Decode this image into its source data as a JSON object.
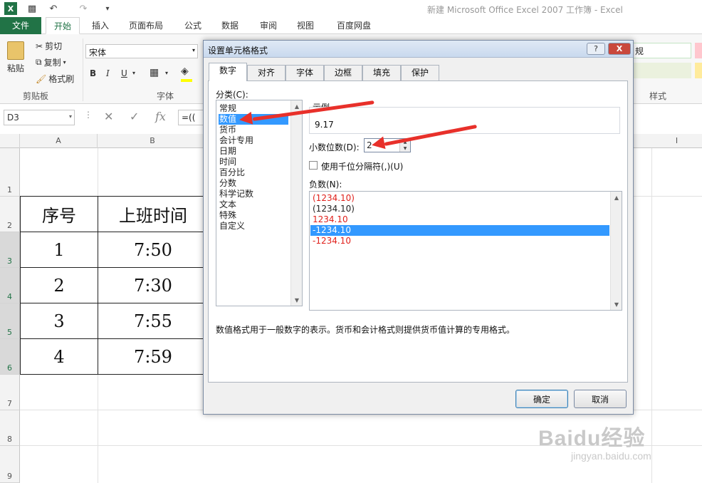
{
  "window": {
    "title": "新建 Microsoft Office Excel 2007 工作簿 - Excel",
    "qat_icons": [
      "excel-logo-icon",
      "save-icon",
      "undo-icon",
      "redo-icon",
      "customize-icon"
    ]
  },
  "ribbon_tabs": [
    "文件",
    "开始",
    "插入",
    "页面布局",
    "公式",
    "数据",
    "审阅",
    "视图",
    "百度网盘"
  ],
  "ribbon": {
    "paste": "粘贴",
    "cut": "剪切",
    "copy": "复制",
    "format_painter": "格式刷",
    "clipboard_group": "剪贴板",
    "font_name": "宋体",
    "font_group": "字体",
    "bold": "B",
    "italic": "I",
    "underline": "U",
    "number_format_partial": "规",
    "styles_group": "样式"
  },
  "formula_bar": {
    "name_box": "D3",
    "fx": "fx",
    "formula_partial": "=(("
  },
  "sheet": {
    "columns": [
      "A",
      "B",
      "I"
    ],
    "rows": [
      "1",
      "2",
      "3",
      "4",
      "5",
      "6",
      "7",
      "8",
      "9"
    ],
    "headers": [
      "序号",
      "上班时间"
    ],
    "data": [
      {
        "no": "1",
        "time": "7:50"
      },
      {
        "no": "2",
        "time": "7:30"
      },
      {
        "no": "3",
        "time": "7:55"
      },
      {
        "no": "4",
        "time": "7:59"
      }
    ]
  },
  "dialog": {
    "title": "设置单元格格式",
    "help": "?",
    "close": "X",
    "tabs": [
      "数字",
      "对齐",
      "字体",
      "边框",
      "填充",
      "保护"
    ],
    "category_label": "分类(C):",
    "categories": [
      "常规",
      "数值",
      "货币",
      "会计专用",
      "日期",
      "时间",
      "百分比",
      "分数",
      "科学记数",
      "文本",
      "特殊",
      "自定义"
    ],
    "selected_category": "数值",
    "sample_label": "示例",
    "sample_value": "9.17",
    "decimal_label": "小数位数(D):",
    "decimal_value": "2",
    "thousands_label": "使用千位分隔符(,)(U)",
    "negative_label": "负数(N):",
    "negative_options": [
      {
        "text": "(1234.10)",
        "style": "red"
      },
      {
        "text": "(1234.10)",
        "style": "normal"
      },
      {
        "text": "1234.10",
        "style": "red"
      },
      {
        "text": "-1234.10",
        "style": "selected"
      },
      {
        "text": "-1234.10",
        "style": "red"
      }
    ],
    "description": "数值格式用于一般数字的表示。货币和会计格式则提供货币值计算的专用格式。",
    "ok": "确定",
    "cancel": "取消"
  },
  "watermark": {
    "main": "Baidu经验",
    "sub": "jingyan.baidu.com"
  },
  "colors": {
    "excel_green": "#217346",
    "selection_blue": "#3399ff",
    "negative_red": "#e0201b",
    "annotation_arrow": "#e8302a"
  }
}
